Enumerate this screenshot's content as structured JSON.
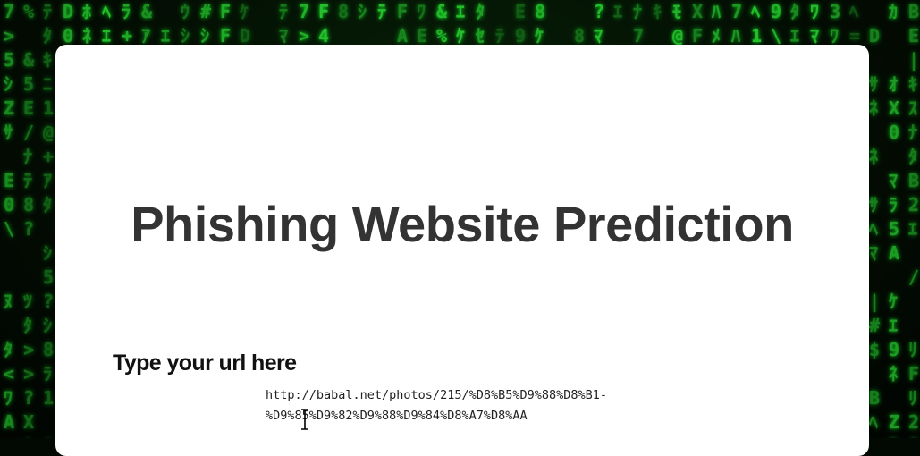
{
  "page": {
    "title": "Phishing Website Prediction",
    "url_label": "Type your url here",
    "url_value_line1": "http://babal.net/photos/215/%D8%B5%D9%88%D8%B1-",
    "url_value_line2": "%D9%85%D9%82%D9%88%D9%84%D8%A7%D8%AA"
  },
  "colors": {
    "background": "#020802",
    "matrix_green": "#27c92f",
    "card": "#ffffff",
    "title_text": "#333333"
  }
}
